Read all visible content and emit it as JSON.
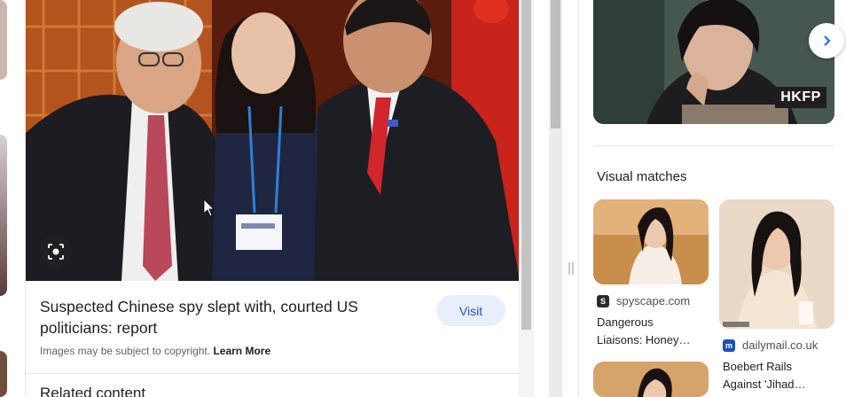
{
  "preview": {
    "title": "Suspected Chinese spy slept with, courted US politicians: report",
    "visit_label": "Visit",
    "copyright_text": "Images may be subject to copyright.",
    "learn_more": "Learn More",
    "related_heading": "Related content"
  },
  "right_panel": {
    "top_image_watermark": "HKFP",
    "visual_matches_heading": "Visual matches",
    "matches": [
      {
        "source": "spyscape.com",
        "title_line1": "Dangerous",
        "title_line2": "Liaisons: Honey…"
      },
      {
        "source": "dailymail.co.uk",
        "title_line1": "Boebert Rails",
        "title_line2": "Against 'Jihad…"
      }
    ]
  },
  "icons": {
    "lens": "lens-icon",
    "next": "chevron-right-icon",
    "source1": "spyscape-favicon",
    "source2": "dailymail-favicon"
  },
  "colors": {
    "accent": "#1a56c4",
    "visit_bg": "#e8eefb"
  }
}
